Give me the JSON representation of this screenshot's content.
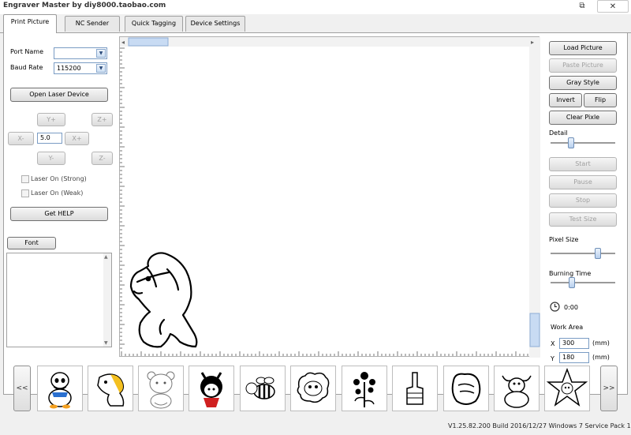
{
  "window": {
    "title": "Engraver Master by diy8000.taobao.com",
    "restore_glyph": "⧉",
    "close_glyph": "✕"
  },
  "tabs": [
    "Print Picture",
    "NC Sender",
    "Quick Tagging",
    "Device Settings"
  ],
  "left": {
    "port_label": "Port Name",
    "port_value": "",
    "baud_label": "Baud Rate",
    "baud_value": "115200",
    "open_button": "Open Laser Device",
    "jog": {
      "y_plus": "Y+",
      "y_minus": "Y-",
      "x_minus": "X-",
      "x_plus": "X+",
      "z_plus": "Z+",
      "z_minus": "Z-",
      "step": "5.0"
    },
    "laser_strong": "Laser On (Strong)",
    "laser_weak": "Laser On (Weak)",
    "help_button": "Get HELP",
    "font_button": "Font"
  },
  "right": {
    "load_picture": "Load Picture",
    "paste_picture": "Paste Picture",
    "gray_style": "Gray Style",
    "invert": "Invert",
    "flip": "Flip",
    "clear_pixle": "Clear Pixle",
    "detail_label": "Detail",
    "detail_level": 0.3,
    "start": "Start",
    "pause": "Pause",
    "stop": "Stop",
    "test_size": "Test Size",
    "pixel_size_label": "Pixel Size",
    "pixel_size_level": 0.76,
    "burning_time_label": "Burning Time",
    "burning_time_level": 0.31,
    "timer": "0:00",
    "work_area_label": "Work Area",
    "x_label": "X",
    "x_value": "300",
    "y_label": "Y",
    "y_value": "180",
    "unit": "(mm)"
  },
  "thumbnails": {
    "prev": "<<",
    "next": ">>",
    "items": [
      "duck",
      "pony",
      "bear",
      "girl",
      "bee",
      "sheep",
      "flower",
      "middle-finger",
      "fist",
      "bull",
      "star"
    ]
  },
  "status": "V1.25.82.200 Build 2016/12/27 Windows 7 Service Pack 1"
}
